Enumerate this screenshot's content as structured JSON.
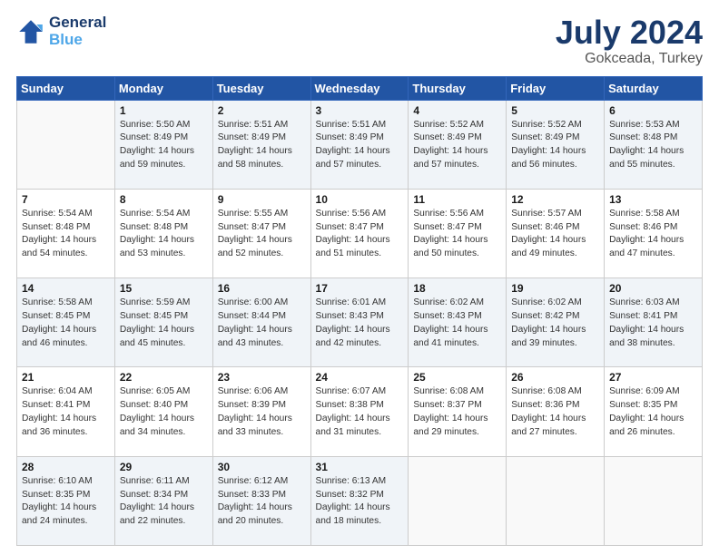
{
  "logo": {
    "line1": "General",
    "line2": "Blue"
  },
  "title": "July 2024",
  "subtitle": "Gokceada, Turkey",
  "header_days": [
    "Sunday",
    "Monday",
    "Tuesday",
    "Wednesday",
    "Thursday",
    "Friday",
    "Saturday"
  ],
  "weeks": [
    [
      {
        "day": "",
        "info": ""
      },
      {
        "day": "1",
        "info": "Sunrise: 5:50 AM\nSunset: 8:49 PM\nDaylight: 14 hours\nand 59 minutes."
      },
      {
        "day": "2",
        "info": "Sunrise: 5:51 AM\nSunset: 8:49 PM\nDaylight: 14 hours\nand 58 minutes."
      },
      {
        "day": "3",
        "info": "Sunrise: 5:51 AM\nSunset: 8:49 PM\nDaylight: 14 hours\nand 57 minutes."
      },
      {
        "day": "4",
        "info": "Sunrise: 5:52 AM\nSunset: 8:49 PM\nDaylight: 14 hours\nand 57 minutes."
      },
      {
        "day": "5",
        "info": "Sunrise: 5:52 AM\nSunset: 8:49 PM\nDaylight: 14 hours\nand 56 minutes."
      },
      {
        "day": "6",
        "info": "Sunrise: 5:53 AM\nSunset: 8:48 PM\nDaylight: 14 hours\nand 55 minutes."
      }
    ],
    [
      {
        "day": "7",
        "info": "Sunrise: 5:54 AM\nSunset: 8:48 PM\nDaylight: 14 hours\nand 54 minutes."
      },
      {
        "day": "8",
        "info": "Sunrise: 5:54 AM\nSunset: 8:48 PM\nDaylight: 14 hours\nand 53 minutes."
      },
      {
        "day": "9",
        "info": "Sunrise: 5:55 AM\nSunset: 8:47 PM\nDaylight: 14 hours\nand 52 minutes."
      },
      {
        "day": "10",
        "info": "Sunrise: 5:56 AM\nSunset: 8:47 PM\nDaylight: 14 hours\nand 51 minutes."
      },
      {
        "day": "11",
        "info": "Sunrise: 5:56 AM\nSunset: 8:47 PM\nDaylight: 14 hours\nand 50 minutes."
      },
      {
        "day": "12",
        "info": "Sunrise: 5:57 AM\nSunset: 8:46 PM\nDaylight: 14 hours\nand 49 minutes."
      },
      {
        "day": "13",
        "info": "Sunrise: 5:58 AM\nSunset: 8:46 PM\nDaylight: 14 hours\nand 47 minutes."
      }
    ],
    [
      {
        "day": "14",
        "info": "Sunrise: 5:58 AM\nSunset: 8:45 PM\nDaylight: 14 hours\nand 46 minutes."
      },
      {
        "day": "15",
        "info": "Sunrise: 5:59 AM\nSunset: 8:45 PM\nDaylight: 14 hours\nand 45 minutes."
      },
      {
        "day": "16",
        "info": "Sunrise: 6:00 AM\nSunset: 8:44 PM\nDaylight: 14 hours\nand 43 minutes."
      },
      {
        "day": "17",
        "info": "Sunrise: 6:01 AM\nSunset: 8:43 PM\nDaylight: 14 hours\nand 42 minutes."
      },
      {
        "day": "18",
        "info": "Sunrise: 6:02 AM\nSunset: 8:43 PM\nDaylight: 14 hours\nand 41 minutes."
      },
      {
        "day": "19",
        "info": "Sunrise: 6:02 AM\nSunset: 8:42 PM\nDaylight: 14 hours\nand 39 minutes."
      },
      {
        "day": "20",
        "info": "Sunrise: 6:03 AM\nSunset: 8:41 PM\nDaylight: 14 hours\nand 38 minutes."
      }
    ],
    [
      {
        "day": "21",
        "info": "Sunrise: 6:04 AM\nSunset: 8:41 PM\nDaylight: 14 hours\nand 36 minutes."
      },
      {
        "day": "22",
        "info": "Sunrise: 6:05 AM\nSunset: 8:40 PM\nDaylight: 14 hours\nand 34 minutes."
      },
      {
        "day": "23",
        "info": "Sunrise: 6:06 AM\nSunset: 8:39 PM\nDaylight: 14 hours\nand 33 minutes."
      },
      {
        "day": "24",
        "info": "Sunrise: 6:07 AM\nSunset: 8:38 PM\nDaylight: 14 hours\nand 31 minutes."
      },
      {
        "day": "25",
        "info": "Sunrise: 6:08 AM\nSunset: 8:37 PM\nDaylight: 14 hours\nand 29 minutes."
      },
      {
        "day": "26",
        "info": "Sunrise: 6:08 AM\nSunset: 8:36 PM\nDaylight: 14 hours\nand 27 minutes."
      },
      {
        "day": "27",
        "info": "Sunrise: 6:09 AM\nSunset: 8:35 PM\nDaylight: 14 hours\nand 26 minutes."
      }
    ],
    [
      {
        "day": "28",
        "info": "Sunrise: 6:10 AM\nSunset: 8:35 PM\nDaylight: 14 hours\nand 24 minutes."
      },
      {
        "day": "29",
        "info": "Sunrise: 6:11 AM\nSunset: 8:34 PM\nDaylight: 14 hours\nand 22 minutes."
      },
      {
        "day": "30",
        "info": "Sunrise: 6:12 AM\nSunset: 8:33 PM\nDaylight: 14 hours\nand 20 minutes."
      },
      {
        "day": "31",
        "info": "Sunrise: 6:13 AM\nSunset: 8:32 PM\nDaylight: 14 hours\nand 18 minutes."
      },
      {
        "day": "",
        "info": ""
      },
      {
        "day": "",
        "info": ""
      },
      {
        "day": "",
        "info": ""
      }
    ]
  ]
}
